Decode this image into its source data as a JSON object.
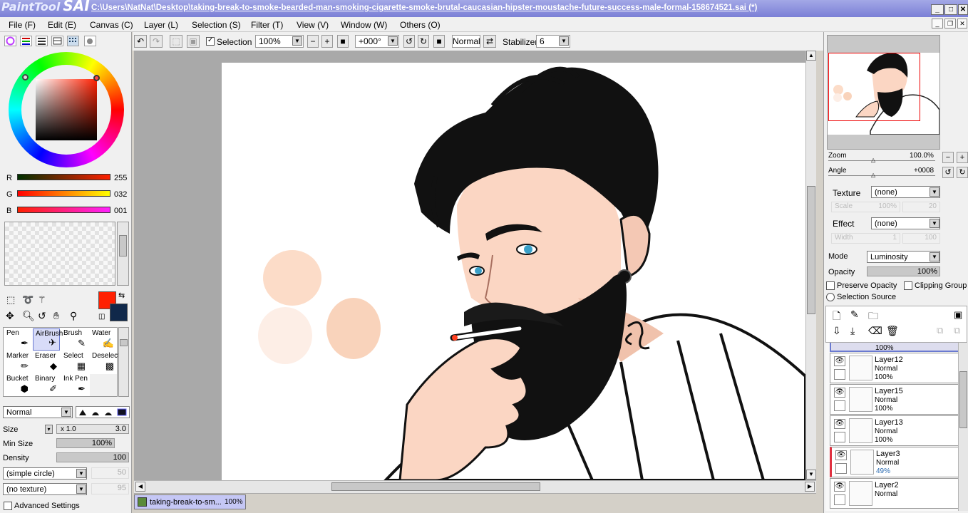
{
  "titlebar": {
    "logo_small": "PaintTool",
    "logo_big": "SAI",
    "title": "C:\\Users\\NatNat\\Desktop\\taking-break-to-smoke-bearded-man-smoking-cigarette-smoke-brutal-caucasian-hipster-moustache-future-success-male-formal-158674521.sai (*)"
  },
  "menu": [
    "File (F)",
    "Edit (E)",
    "Canvas (C)",
    "Layer (L)",
    "Selection (S)",
    "Filter (T)",
    "View (V)",
    "Window (W)",
    "Others (O)"
  ],
  "toolbar": {
    "selection_label": "Selection",
    "zoom": "100%",
    "angle": "+000°",
    "blend": "Normal",
    "stabilizer_label": "Stabilizer",
    "stabilizer": "6"
  },
  "color": {
    "r_label": "R",
    "r": "255",
    "g_label": "G",
    "g": "032",
    "b_label": "B",
    "b": "001",
    "primary": "#ff2001",
    "secondary": "#10284a"
  },
  "tools": [
    {
      "name": "Pen",
      "icon": "✒"
    },
    {
      "name": "AirBrush",
      "icon": "✈"
    },
    {
      "name": "Brush",
      "icon": "✎"
    },
    {
      "name": "Water",
      "icon": "✍"
    },
    {
      "name": "Marker",
      "icon": "✏"
    },
    {
      "name": "Eraser",
      "icon": "◆"
    },
    {
      "name": "Select",
      "icon": "▦"
    },
    {
      "name": "Deselect",
      "icon": "▩"
    },
    {
      "name": "Bucket",
      "icon": "⬢"
    },
    {
      "name": "Binary",
      "icon": "✐"
    },
    {
      "name": "Ink Pen",
      "icon": "✒"
    }
  ],
  "brush": {
    "blend": "Normal",
    "size_label": "Size",
    "size_mult": "x 1.0",
    "size": "3.0",
    "minsize_label": "Min Size",
    "minsize": "100%",
    "density_label": "Density",
    "density": "100",
    "shape": "(simple circle)",
    "shape_val": "50",
    "texture": "(no texture)",
    "texture_val": "95",
    "advanced": "Advanced Settings"
  },
  "navigator": {
    "zoom_label": "Zoom",
    "zoom": "100.0%",
    "angle_label": "Angle",
    "angle": "+0008"
  },
  "layerprops": {
    "texture_label": "Texture",
    "texture": "(none)",
    "scale_label": "Scale",
    "scale": "100%",
    "scale_val": "20",
    "effect_label": "Effect",
    "effect": "(none)",
    "width_label": "Width",
    "width": "1",
    "width_val": "100",
    "mode_label": "Mode",
    "mode": "Luminosity",
    "opacity_label": "Opacity",
    "opacity": "100%",
    "preserve": "Preserve Opacity",
    "clipping": "Clipping Group",
    "selsource": "Selection Source"
  },
  "layers": [
    {
      "name": "",
      "mode": "",
      "opacity": "100%"
    },
    {
      "name": "Layer12",
      "mode": "Normal",
      "opacity": "100%"
    },
    {
      "name": "Layer15",
      "mode": "Normal",
      "opacity": "100%"
    },
    {
      "name": "Layer13",
      "mode": "Normal",
      "opacity": "100%"
    },
    {
      "name": "Layer3",
      "mode": "Normal",
      "opacity": "49%"
    },
    {
      "name": "Layer2",
      "mode": "Normal",
      "opacity": ""
    }
  ],
  "doc": {
    "tab": "taking-break-to-sm...",
    "zoom": "100%"
  },
  "colors": {
    "accent": "#7b7fd6",
    "skin": "#fcdcc8",
    "hair": "#111111",
    "iris": "#3aa0c8"
  }
}
